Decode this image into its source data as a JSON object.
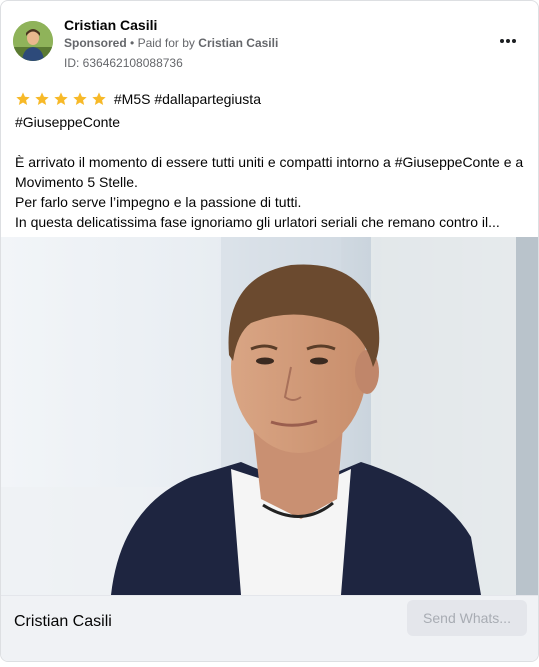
{
  "post": {
    "author": "Cristian Casili",
    "sponsored_label": "Sponsored",
    "separator": "•",
    "paid_for_prefix": "Paid for by",
    "paid_for_name": "Cristian Casili",
    "ad_id": "ID: 636462108088736",
    "more_label": "More options"
  },
  "text": {
    "hashtags_line1": "#M5S #dallapartegiusta",
    "hashtags_line2": "#GiuseppeConte",
    "p1_line1": "È arrivato il momento di essere tutti uniti e compatti intorno a #GiuseppeConte e al",
    "p1_line2": "Movimento 5 Stelle.",
    "p2_line1": "Per farlo serve l’impegno e la passione di tutti.",
    "p3_line1": "In questa delicatissima fase ignoriamo gli urlatori seriali che remano contro il..."
  },
  "rating": {
    "stars": 5,
    "max": 5,
    "color": "#f7b928"
  },
  "footer": {
    "name": "Cristian Casili",
    "cta_label": "Send Whats..."
  },
  "colors": {
    "text": "#050505",
    "secondary": "#65676b",
    "footer_bg": "#f0f2f5",
    "cta_bg": "#e4e6eb"
  }
}
